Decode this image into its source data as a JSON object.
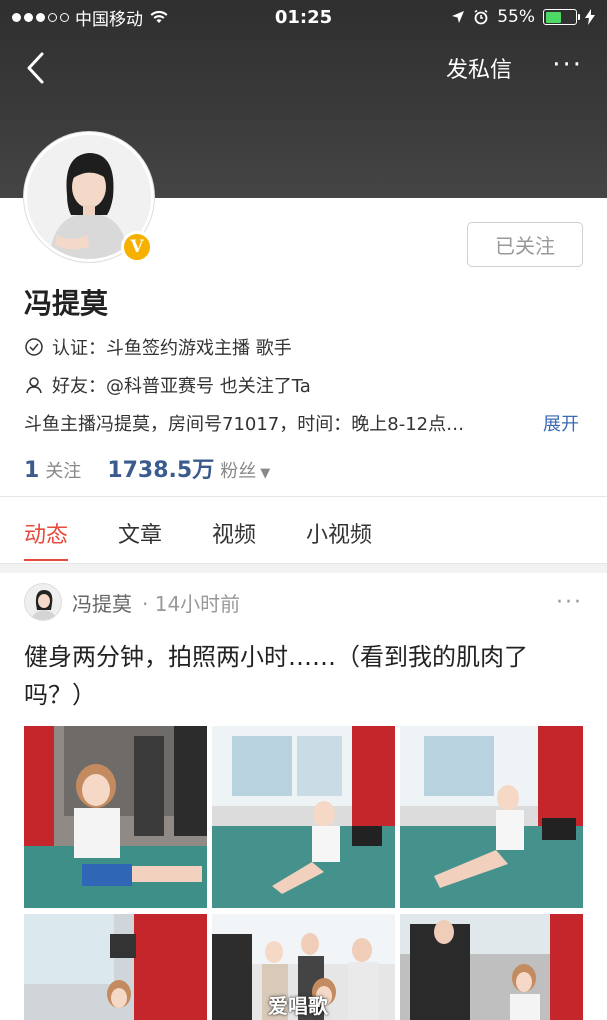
{
  "status_bar": {
    "carrier": "中国移动",
    "time": "01:25",
    "battery": "55%",
    "battery_level": 0.55
  },
  "nav": {
    "message_label": "发私信",
    "more_label": "···"
  },
  "profile": {
    "name": "冯提莫",
    "follow_label": "已关注",
    "verified_badge": "V",
    "verification_label": "认证：",
    "verification_text": "斗鱼签约游戏主播 歌手",
    "friends_label": "好友：",
    "friends_text": "@科普亚赛号 也关注了Ta",
    "bio": "斗鱼主播冯提莫，房间号71017，时间：晚上8-12点…",
    "expand_label": "展开",
    "following_count": "1",
    "following_label": "关注",
    "followers_count": "1738.5万",
    "followers_label": "粉丝"
  },
  "tabs": [
    {
      "label": "动态",
      "active": true
    },
    {
      "label": "文章",
      "active": false
    },
    {
      "label": "视频",
      "active": false
    },
    {
      "label": "小视频",
      "active": false
    }
  ],
  "post": {
    "author": "冯提莫",
    "time": "· 14小时前",
    "more_label": "···",
    "text": "健身两分钟，拍照两小时……（看到我的肌肉了吗？）"
  },
  "watermark": "爱唱歌",
  "colors": {
    "accent_red": "#e84b3c",
    "link_blue": "#3b6bb5",
    "badge_gold": "#f6b100",
    "battery_green": "#4cd964"
  }
}
